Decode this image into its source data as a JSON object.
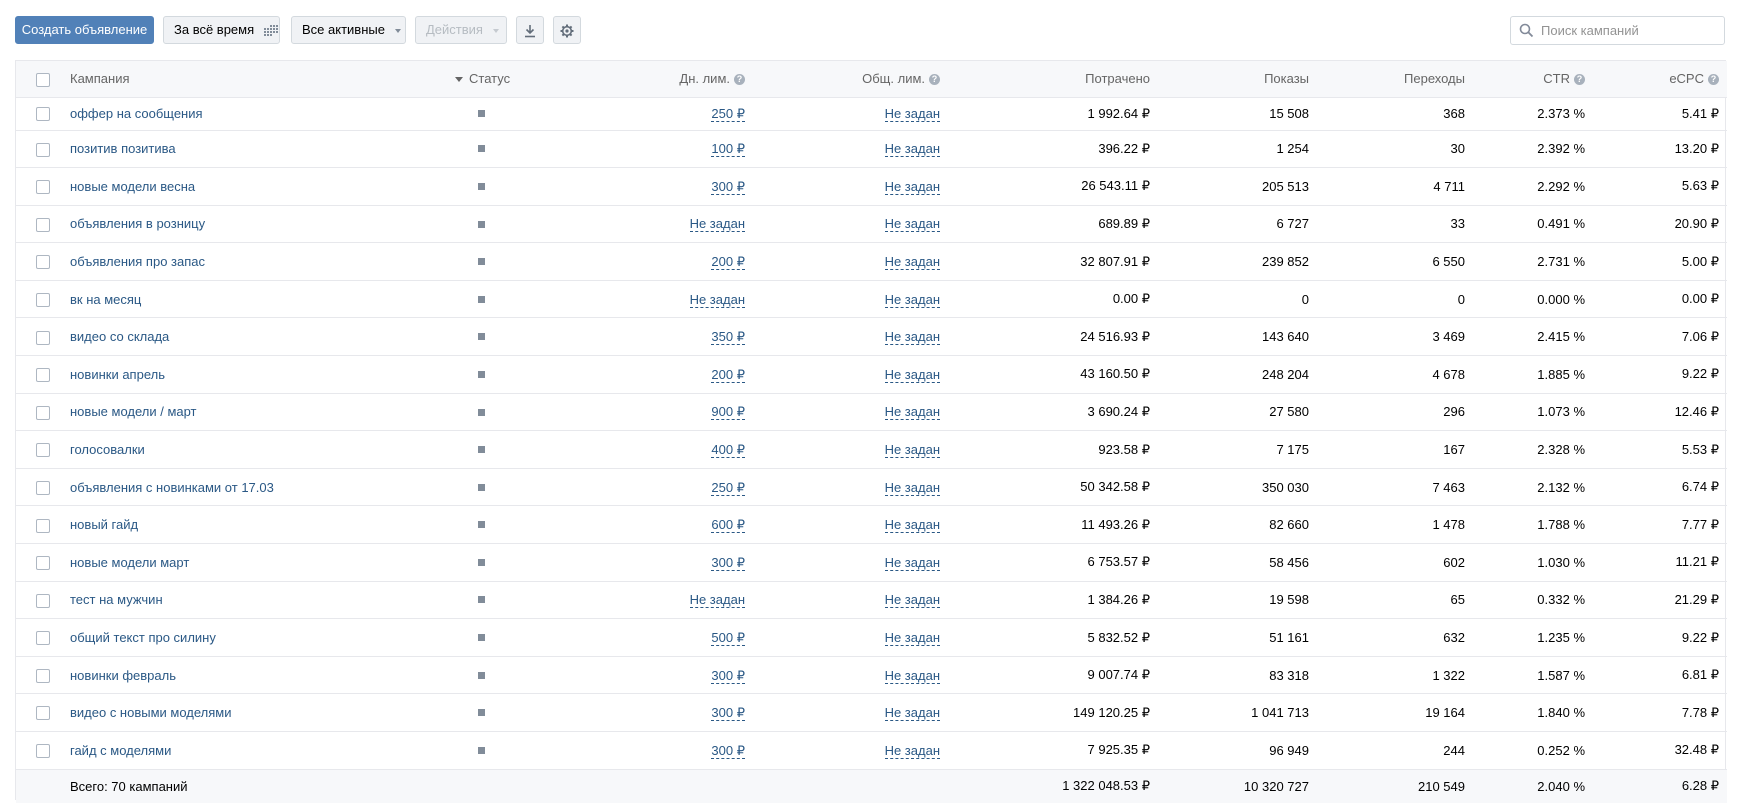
{
  "toolbar": {
    "create_label": "Создать объявление",
    "period_label": "За всё время",
    "filter_label": "Все активные",
    "actions_label": "Действия",
    "search_placeholder": "Поиск кампаний"
  },
  "colors": {
    "primary": "#5181b8",
    "link": "#2a5885",
    "header_bg": "#f7f8fa",
    "border": "#e7e8ec",
    "status_dot": "#818c99"
  },
  "table": {
    "headers": {
      "name": "Кампания",
      "status": "Статус",
      "daily_limit": "Дн. лим.",
      "total_limit": "Общ. лим.",
      "spent": "Потрачено",
      "shows": "Показы",
      "clicks": "Переходы",
      "ctr": "CTR",
      "ecpc": "eCPC"
    },
    "rows": [
      {
        "name": "оффер на сообщения",
        "daily": "250 ₽",
        "total": "Не задан",
        "spent": "1 992.64 ₽",
        "shows": "15 508",
        "clicks": "368",
        "ctr": "2.373 %",
        "ecpc": "5.41 ₽"
      },
      {
        "name": "позитив позитива",
        "daily": "100 ₽",
        "total": "Не задан",
        "spent": "396.22 ₽",
        "shows": "1 254",
        "clicks": "30",
        "ctr": "2.392 %",
        "ecpc": "13.20 ₽"
      },
      {
        "name": "новые модели весна",
        "daily": "300 ₽",
        "total": "Не задан",
        "spent": "26 543.11 ₽",
        "shows": "205 513",
        "clicks": "4 711",
        "ctr": "2.292 %",
        "ecpc": "5.63 ₽"
      },
      {
        "name": "объявления в розницу",
        "daily": "Не задан",
        "total": "Не задан",
        "spent": "689.89 ₽",
        "shows": "6 727",
        "clicks": "33",
        "ctr": "0.491 %",
        "ecpc": "20.90 ₽"
      },
      {
        "name": "объявления про запас",
        "daily": "200 ₽",
        "total": "Не задан",
        "spent": "32 807.91 ₽",
        "shows": "239 852",
        "clicks": "6 550",
        "ctr": "2.731 %",
        "ecpc": "5.00 ₽"
      },
      {
        "name": "вк на месяц",
        "daily": "Не задан",
        "total": "Не задан",
        "spent": "0.00 ₽",
        "shows": "0",
        "clicks": "0",
        "ctr": "0.000 %",
        "ecpc": "0.00 ₽"
      },
      {
        "name": "видео со склада",
        "daily": "350 ₽",
        "total": "Не задан",
        "spent": "24 516.93 ₽",
        "shows": "143 640",
        "clicks": "3 469",
        "ctr": "2.415 %",
        "ecpc": "7.06 ₽"
      },
      {
        "name": "новинки апрель",
        "daily": "200 ₽",
        "total": "Не задан",
        "spent": "43 160.50 ₽",
        "shows": "248 204",
        "clicks": "4 678",
        "ctr": "1.885 %",
        "ecpc": "9.22 ₽"
      },
      {
        "name": "новые модели / март",
        "daily": "900 ₽",
        "total": "Не задан",
        "spent": "3 690.24 ₽",
        "shows": "27 580",
        "clicks": "296",
        "ctr": "1.073 %",
        "ecpc": "12.46 ₽"
      },
      {
        "name": "голосовалки",
        "daily": "400 ₽",
        "total": "Не задан",
        "spent": "923.58 ₽",
        "shows": "7 175",
        "clicks": "167",
        "ctr": "2.328 %",
        "ecpc": "5.53 ₽"
      },
      {
        "name": "объявления с новинками от 17.03",
        "daily": "250 ₽",
        "total": "Не задан",
        "spent": "50 342.58 ₽",
        "shows": "350 030",
        "clicks": "7 463",
        "ctr": "2.132 %",
        "ecpc": "6.74 ₽"
      },
      {
        "name": "новый гайд",
        "daily": "600 ₽",
        "total": "Не задан",
        "spent": "11 493.26 ₽",
        "shows": "82 660",
        "clicks": "1 478",
        "ctr": "1.788 %",
        "ecpc": "7.77 ₽"
      },
      {
        "name": "новые модели март",
        "daily": "300 ₽",
        "total": "Не задан",
        "spent": "6 753.57 ₽",
        "shows": "58 456",
        "clicks": "602",
        "ctr": "1.030 %",
        "ecpc": "11.21 ₽"
      },
      {
        "name": "тест на мужчин",
        "daily": "Не задан",
        "total": "Не задан",
        "spent": "1 384.26 ₽",
        "shows": "19 598",
        "clicks": "65",
        "ctr": "0.332 %",
        "ecpc": "21.29 ₽"
      },
      {
        "name": "общий текст про силину",
        "daily": "500 ₽",
        "total": "Не задан",
        "spent": "5 832.52 ₽",
        "shows": "51 161",
        "clicks": "632",
        "ctr": "1.235 %",
        "ecpc": "9.22 ₽"
      },
      {
        "name": "новинки февраль",
        "daily": "300 ₽",
        "total": "Не задан",
        "spent": "9 007.74 ₽",
        "shows": "83 318",
        "clicks": "1 322",
        "ctr": "1.587 %",
        "ecpc": "6.81 ₽"
      },
      {
        "name": "видео с новыми моделями",
        "daily": "300 ₽",
        "total": "Не задан",
        "spent": "149 120.25 ₽",
        "shows": "1 041 713",
        "clicks": "19 164",
        "ctr": "1.840 %",
        "ecpc": "7.78 ₽"
      },
      {
        "name": "гайд с моделями",
        "daily": "300 ₽",
        "total": "Не задан",
        "spent": "7 925.35 ₽",
        "shows": "96 949",
        "clicks": "244",
        "ctr": "0.252 %",
        "ecpc": "32.48 ₽"
      }
    ],
    "footer": {
      "label": "Всего: 70 кампаний",
      "spent": "1 322 048.53 ₽",
      "shows": "10 320 727",
      "clicks": "210 549",
      "ctr": "2.040 %",
      "ecpc": "6.28 ₽"
    }
  }
}
